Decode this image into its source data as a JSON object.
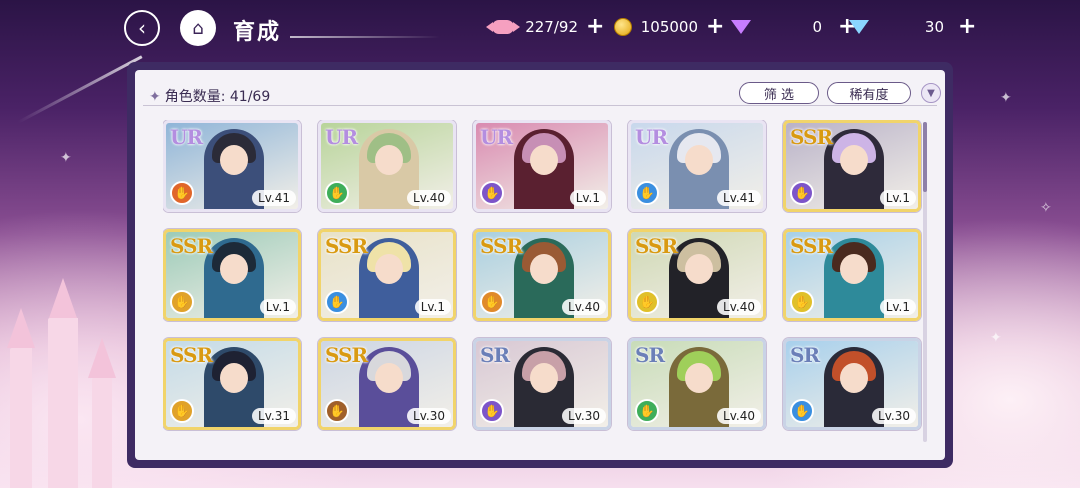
{
  "header": {
    "back_icon": "back-arrow-icon",
    "home_icon": "castle-icon",
    "title": "育成"
  },
  "currencies": [
    {
      "name": "candy",
      "icon": "candy-icon",
      "value": "227/92"
    },
    {
      "name": "coin",
      "icon": "coin-icon",
      "value": "105000"
    },
    {
      "name": "purple-gem",
      "icon": "purple-gem-icon",
      "value": "0"
    },
    {
      "name": "blue-gem",
      "icon": "blue-gem-icon",
      "value": "30"
    }
  ],
  "plus_label": "+",
  "list": {
    "count_label": "角色数量: 41/69",
    "filter_label": "筛 选",
    "rarity_label": "稀有度",
    "sort_icon": "sort-toggle-icon"
  },
  "cards": [
    {
      "rarity": "UR",
      "level": "Lv.41",
      "attr_color": "#e0662a",
      "bg": "#8fb5d8",
      "hair": "#2b2b38",
      "outfit": "#3c4f7a"
    },
    {
      "rarity": "UR",
      "level": "Lv.40",
      "attr_color": "#3fae5a",
      "bg": "#b8d49a",
      "hair": "#9fbf86",
      "outfit": "#d9c9a6"
    },
    {
      "rarity": "UR",
      "level": "Lv.1",
      "attr_color": "#7d55c9",
      "bg": "#d98ab0",
      "hair": "#c78fb5",
      "outfit": "#5a2030"
    },
    {
      "rarity": "UR",
      "level": "Lv.41",
      "attr_color": "#3a8fe0",
      "bg": "#c8d8ec",
      "hair": "#e6e8f0",
      "outfit": "#7a8fb0"
    },
    {
      "rarity": "SSR",
      "level": "Lv.1",
      "attr_color": "#7d55c9",
      "bg": "#b9b2c8",
      "hair": "#cdb4e6",
      "outfit": "#2e2a3a"
    },
    {
      "rarity": "SSR",
      "level": "Lv.1",
      "attr_color": "#e0a22a",
      "bg": "#9ccbb8",
      "hair": "#1d2a38",
      "outfit": "#2f6a8f"
    },
    {
      "rarity": "SSR",
      "level": "Lv.1",
      "attr_color": "#3a8fe0",
      "bg": "#e8e2c8",
      "hair": "#efe2a8",
      "outfit": "#3f5e9c"
    },
    {
      "rarity": "SSR",
      "level": "Lv.40",
      "attr_color": "#e08a2a",
      "bg": "#a9cfe0",
      "hair": "#9a5a34",
      "outfit": "#2a6a5a"
    },
    {
      "rarity": "SSR",
      "level": "Lv.40",
      "attr_color": "#e0c02a",
      "bg": "#cfd8b4",
      "hair": "#cdbfa0",
      "outfit": "#222228"
    },
    {
      "rarity": "SSR",
      "level": "Lv.1",
      "attr_color": "#e0c02a",
      "bg": "#a7d0e8",
      "hair": "#4a2a1e",
      "outfit": "#2e8a9a"
    },
    {
      "rarity": "SSR",
      "level": "Lv.31",
      "attr_color": "#e0a22a",
      "bg": "#c4dbe8",
      "hair": "#1e2233",
      "outfit": "#2e4a6a"
    },
    {
      "rarity": "SSR",
      "level": "Lv.30",
      "attr_color": "#a0602a",
      "bg": "#cdd6e4",
      "hair": "#d8d8dc",
      "outfit": "#5a4e9a"
    },
    {
      "rarity": "SR",
      "level": "Lv.30",
      "attr_color": "#7d55c9",
      "bg": "#d8c8d4",
      "hair": "#c8a0a8",
      "outfit": "#2a2a34"
    },
    {
      "rarity": "SR",
      "level": "Lv.40",
      "attr_color": "#3fae5a",
      "bg": "#c8dcb8",
      "hair": "#9fcf5a",
      "outfit": "#7a6a3a"
    },
    {
      "rarity": "SR",
      "level": "Lv.30",
      "attr_color": "#3a8fe0",
      "bg": "#a8d0ec",
      "hair": "#c2502a",
      "outfit": "#2a2a38"
    }
  ],
  "colors": {
    "panel_frame": "#3e2b63",
    "panel_bg": "#f4f2f7",
    "ur_border": "#e9e4f3",
    "ssr_border": "#f1d46a",
    "sr_border": "#c9d3e6"
  }
}
